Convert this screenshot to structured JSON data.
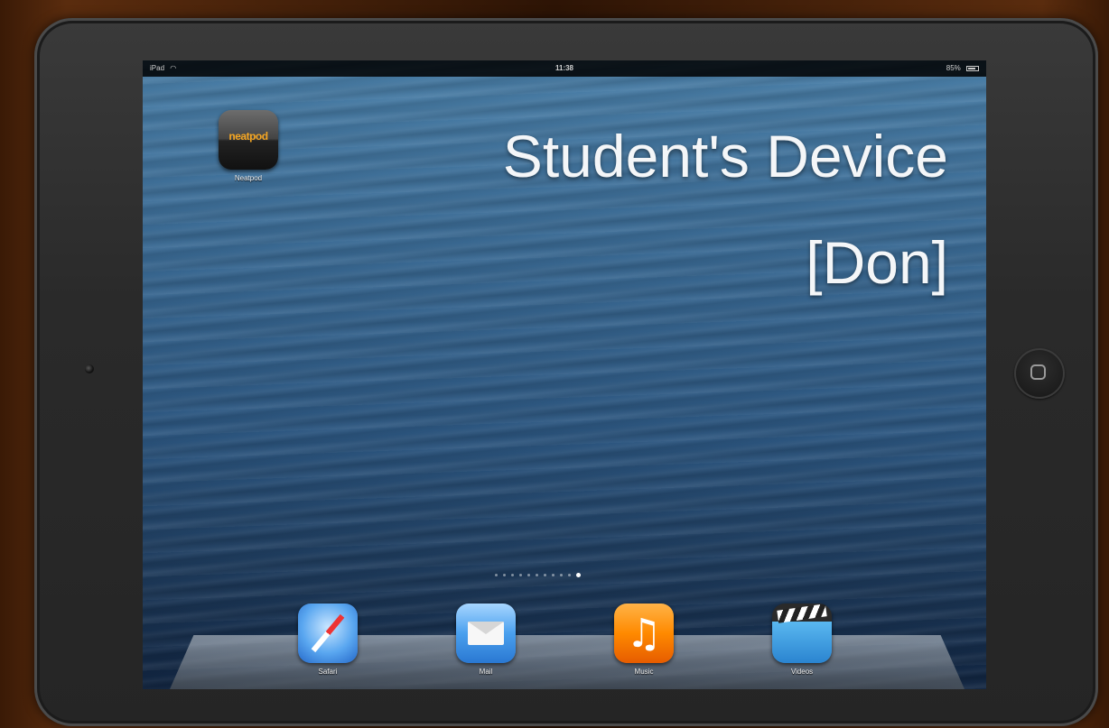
{
  "status_bar": {
    "carrier": "iPad",
    "time": "11:38",
    "battery": "85%"
  },
  "overlay": {
    "title": "Student's Device",
    "subtitle": "[Don]"
  },
  "home_apps": [
    {
      "label": "Neatpod",
      "icon": "neatpod-icon",
      "logo_text": "neatpod"
    }
  ],
  "page_indicator": {
    "count": 11,
    "active_index": 10
  },
  "dock": [
    {
      "label": "Safari",
      "icon": "safari-icon"
    },
    {
      "label": "Mail",
      "icon": "mail-icon"
    },
    {
      "label": "Music",
      "icon": "music-icon",
      "glyph": "♫"
    },
    {
      "label": "Videos",
      "icon": "videos-icon"
    }
  ],
  "colors": {
    "wallpaper": "#2c5680",
    "overlay_text": "#f4f6f8",
    "music_orange": "#ff8a00",
    "safari_blue": "#5aa7f0"
  }
}
